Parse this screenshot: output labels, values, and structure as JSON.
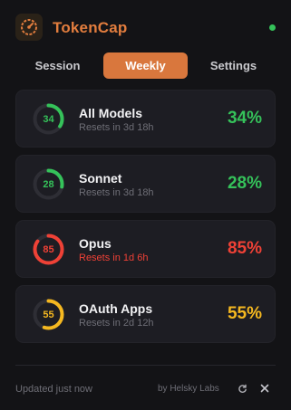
{
  "app": {
    "title": "TokenCap",
    "logo_icon": "gauge-icon",
    "status_color": "#35c25a",
    "accent_color": "#d9773d"
  },
  "tabs": [
    {
      "label": "Session",
      "active": false
    },
    {
      "label": "Weekly",
      "active": true
    },
    {
      "label": "Settings",
      "active": false
    }
  ],
  "cards": [
    {
      "name": "All Models",
      "reset": "Resets in 3d 18h",
      "percent": 34,
      "label": "34",
      "percent_text": "34%",
      "color": "#35c25a",
      "reset_color": "#6e6e76"
    },
    {
      "name": "Sonnet",
      "reset": "Resets in 3d 18h",
      "percent": 28,
      "label": "28",
      "percent_text": "28%",
      "color": "#35c25a",
      "reset_color": "#6e6e76"
    },
    {
      "name": "Opus",
      "reset": "Resets in 1d 6h",
      "percent": 85,
      "label": "85",
      "percent_text": "85%",
      "color": "#ef4136",
      "reset_color": "#ef4136"
    },
    {
      "name": "OAuth Apps",
      "reset": "Resets in 2d 12h",
      "percent": 55,
      "label": "55",
      "percent_text": "55%",
      "color": "#f5b820",
      "reset_color": "#6e6e76"
    }
  ],
  "footer": {
    "updated": "Updated just now",
    "brand": "by Helsky Labs",
    "refresh_icon": "refresh-icon",
    "close_icon": "close-icon"
  }
}
